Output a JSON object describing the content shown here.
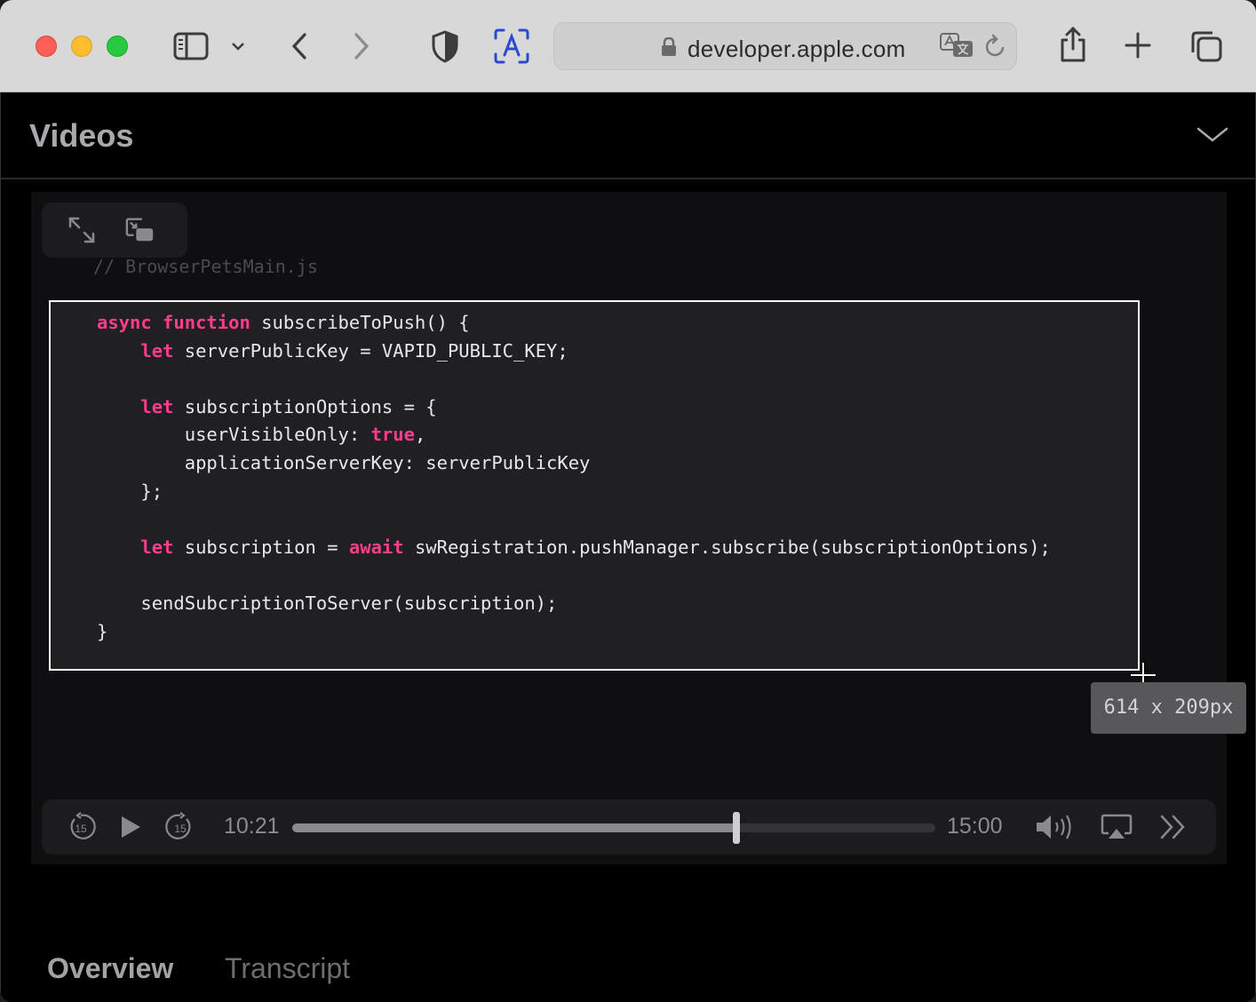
{
  "browser": {
    "url": "developer.apple.com"
  },
  "page": {
    "section_title": "Videos",
    "comment_line": "// BrowserPetsMain.js",
    "code_lines": [
      [
        {
          "t": "async function",
          "k": true
        },
        {
          "t": " subscribeToPush() {"
        }
      ],
      [
        {
          "t": "    "
        },
        {
          "t": "let",
          "k": true
        },
        {
          "t": " serverPublicKey = VAPID_PUBLIC_KEY;"
        }
      ],
      [
        {
          "t": ""
        }
      ],
      [
        {
          "t": "    "
        },
        {
          "t": "let",
          "k": true
        },
        {
          "t": " subscriptionOptions = {"
        }
      ],
      [
        {
          "t": "        userVisibleOnly: "
        },
        {
          "t": "true",
          "k": true
        },
        {
          "t": ","
        }
      ],
      [
        {
          "t": "        applicationServerKey: serverPublicKey"
        }
      ],
      [
        {
          "t": "    };"
        }
      ],
      [
        {
          "t": ""
        }
      ],
      [
        {
          "t": "    "
        },
        {
          "t": "let",
          "k": true
        },
        {
          "t": " subscription = "
        },
        {
          "t": "await",
          "k": true
        },
        {
          "t": " swRegistration.pushManager.subscribe(subscriptionOptions);"
        }
      ],
      [
        {
          "t": ""
        }
      ],
      [
        {
          "t": "    sendSubcriptionToServer(subscription);"
        }
      ],
      [
        {
          "t": "}"
        }
      ]
    ],
    "selection_tooltip": "614 x 209px",
    "player": {
      "current_time": "10:21",
      "duration": "15:00",
      "progress": 0.69,
      "skip_back_label": "15",
      "skip_forward_label": "15"
    },
    "tabs": [
      {
        "label": "Overview",
        "active": true
      },
      {
        "label": "Transcript",
        "active": false
      }
    ]
  },
  "colors": {
    "keyword": "#ff3d8b",
    "code_bg": "#1f1f24"
  }
}
